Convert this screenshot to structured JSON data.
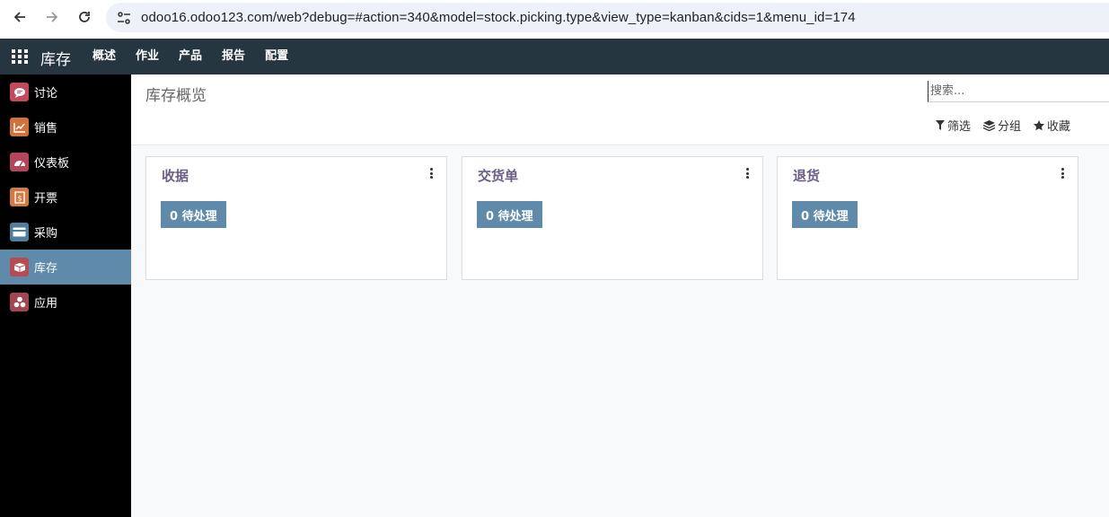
{
  "browser": {
    "url": "odoo16.odoo123.com/web?debug=#action=340&model=stock.picking.type&view_type=kanban&cids=1&menu_id=174"
  },
  "app_nav": {
    "brand": "库存",
    "menu": [
      "概述",
      "作业",
      "产品",
      "报告",
      "配置"
    ]
  },
  "sidebar": {
    "items": [
      {
        "label": "讨论",
        "icon": "chat-icon",
        "color": "#c2495e"
      },
      {
        "label": "销售",
        "icon": "chart-icon",
        "color": "#d1723d"
      },
      {
        "label": "仪表板",
        "icon": "speedometer-icon",
        "color": "#b5455a"
      },
      {
        "label": "开票",
        "icon": "invoice-icon",
        "color": "#d07a45"
      },
      {
        "label": "采购",
        "icon": "credit-card-icon",
        "color": "#4f7f9c"
      },
      {
        "label": "库存",
        "icon": "box-icon",
        "color": "#b64b53",
        "active": true
      },
      {
        "label": "应用",
        "icon": "cubes-icon",
        "color": "#a44651"
      }
    ]
  },
  "control_panel": {
    "title": "库存概览",
    "search_placeholder": "搜索...",
    "filter_label": "筛选",
    "group_label": "分组",
    "favorite_label": "收藏"
  },
  "cards": [
    {
      "title": "收据",
      "button": "0 待处理"
    },
    {
      "title": "交货单",
      "button": "0 待处理"
    },
    {
      "title": "退货",
      "button": "0 待处理"
    }
  ],
  "colors": {
    "navbar": "#263640",
    "accent": "#5f8aa9",
    "card_title": "#6a5d87"
  }
}
